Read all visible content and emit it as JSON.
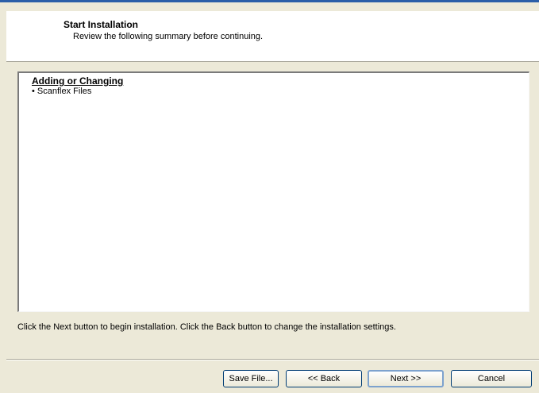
{
  "header": {
    "title": "Start Installation",
    "subtitle": "Review the following summary before continuing."
  },
  "summary": {
    "section_heading": "Adding or Changing",
    "items": [
      "• Scanflex Files"
    ]
  },
  "instruction": "Click the Next button to begin installation.  Click the Back button to change the installation settings.",
  "buttons": {
    "save_file": "Save File...",
    "back": "<< Back",
    "next": "Next >>",
    "cancel": "Cancel"
  }
}
